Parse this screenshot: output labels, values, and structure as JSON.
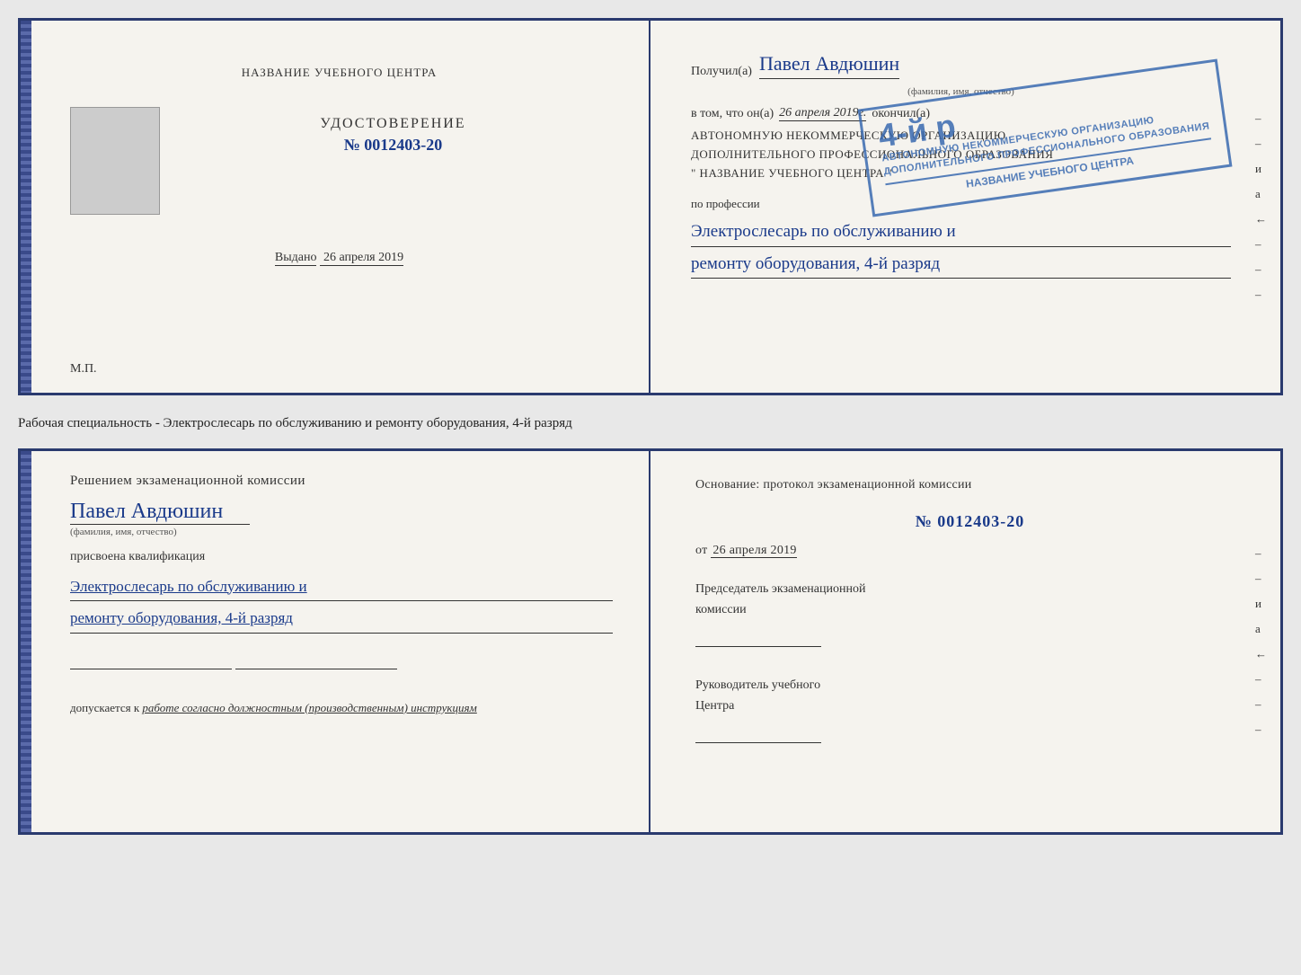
{
  "top_document": {
    "left_page": {
      "center_title": "НАЗВАНИЕ УЧЕБНОГО ЦЕНТРА",
      "udost_label": "УДОСТОВЕРЕНИЕ",
      "cert_number": "№ 0012403-20",
      "issued_label": "Выдано",
      "issued_date": "26 апреля 2019",
      "mp_label": "М.П."
    },
    "right_page": {
      "received_label": "Получил(а)",
      "recipient_name": "Павел Авдюшин",
      "fio_label": "(фамилия, имя, отчество)",
      "vtom_label": "в том, что он(а)",
      "completed_date": "26 апреля 2019г.",
      "okonchil_label": "окончил(а)",
      "org_line1": "АВТОНОМНУЮ НЕКОММЕРЧЕСКУЮ ОРГАНИЗАЦИЮ",
      "org_line2": "ДОПОЛНИТЕЛЬНОГО ПРОФЕССИОНАЛЬНОГО ОБРАЗОВАНИЯ",
      "org_name": "\" НАЗВАНИЕ УЧЕБНОГО ЦЕНТРА \"",
      "po_professii_label": "по профессии",
      "profession_line1": "Электрослесарь по обслуживанию и",
      "profession_line2": "ремонту оборудования, 4-й разряд",
      "stamp_big": "4-й р",
      "stamp_line1": "АВТОНОМНУЮ НЕКОММЕРЧЕСКУЮ ОРГАНИЗАЦИЮ",
      "stamp_line2": "ДОПОЛНИТЕЛЬНОГО ПРОФЕССИОНАЛЬНОГО ОБРАЗОВАНИЯ",
      "stamp_line3": "НАЗВАНИЕ УЧЕБНОГО ЦЕНТРА"
    }
  },
  "caption": {
    "text": "Рабочая специальность - Электрослесарь по обслуживанию и ремонту оборудования, 4-й разряд"
  },
  "bottom_document": {
    "left_page": {
      "komissia_title": "Решением экзаменационной комиссии",
      "person_name": "Павел Авдюшин",
      "fio_label": "(фамилия, имя, отчество)",
      "prisvoyena_label": "присвоена квалификация",
      "qual_line1": "Электрослесарь по обслуживанию и",
      "qual_line2": "ремонту оборудования, 4-й разряд",
      "dopuskaetsya_prefix": "допускается к",
      "dopuskaetsya_italic": "работе согласно должностным (производственным) инструкциям"
    },
    "right_page": {
      "osnovanie_label": "Основание: протокол экзаменационной комиссии",
      "osnov_number": "№ 0012403-20",
      "ot_prefix": "от",
      "ot_date": "26 апреля 2019",
      "predsedatel_line1": "Председатель экзаменационной",
      "predsedatel_line2": "комиссии",
      "rukovoditel_line1": "Руководитель учебного",
      "rukovoditel_line2": "Центра"
    }
  },
  "side_chars": {
    "top_right": [
      "–",
      "–",
      "и",
      "а",
      "←",
      "–",
      "–",
      "–"
    ]
  }
}
